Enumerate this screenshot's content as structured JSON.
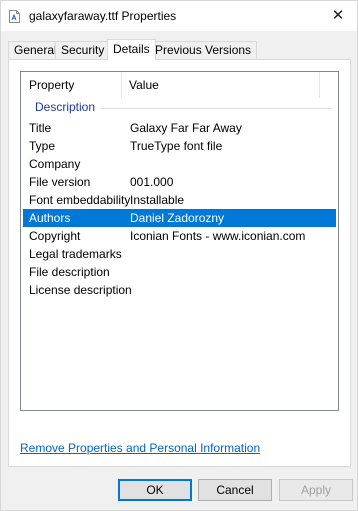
{
  "window": {
    "title": "galaxyfaraway.ttf Properties",
    "close_glyph": "✕",
    "icon": "font-file-icon"
  },
  "tabs": [
    {
      "label": "General",
      "active": false
    },
    {
      "label": "Security",
      "active": false
    },
    {
      "label": "Details",
      "active": true
    },
    {
      "label": "Previous Versions",
      "active": false
    }
  ],
  "details": {
    "columns": {
      "property": "Property",
      "value": "Value"
    },
    "group_label": "Description",
    "rows": [
      {
        "property": "Title",
        "value": "Galaxy Far Far Away"
      },
      {
        "property": "Type",
        "value": "TrueType font file"
      },
      {
        "property": "Company",
        "value": ""
      },
      {
        "property": "File version",
        "value": "001.000"
      },
      {
        "property": "Font embeddability",
        "value": "Installable"
      },
      {
        "property": "Authors",
        "value": "Daniel Zadorozny",
        "selected": true
      },
      {
        "property": "Copyright",
        "value": "Iconian Fonts - www.iconian.com"
      },
      {
        "property": "Legal trademarks",
        "value": ""
      },
      {
        "property": "File description",
        "value": ""
      },
      {
        "property": "License description",
        "value": ""
      }
    ]
  },
  "remove_link": "Remove Properties and Personal Information",
  "buttons": {
    "ok": "OK",
    "cancel": "Cancel",
    "apply": "Apply"
  },
  "colors": {
    "selection": "#0078d7",
    "link": "#0066cc",
    "group_label": "#1e3a9e"
  }
}
